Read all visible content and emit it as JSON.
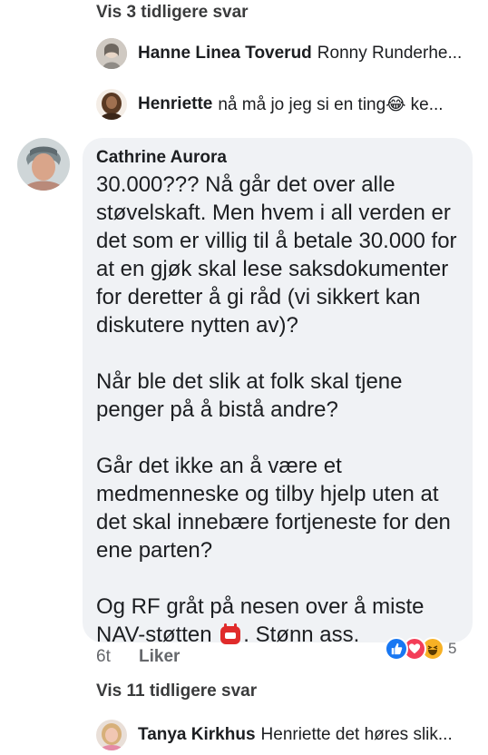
{
  "top_more_replies": "Vis 3 tidligere svar",
  "replies_top": [
    {
      "name": "Hanne Linea Toverud",
      "text": "Ronny Runderhe..."
    },
    {
      "name": "Henriette",
      "text": "nå må jo jeg si en ting😂 ke..."
    }
  ],
  "comment": {
    "author": "Cathrine Aurora",
    "paragraphs": [
      "30.000??? Nå går det over alle støvelskaft. Men hvem i all verden er det som er villig til å betale 30.000 for at en gjøk skal lese saksdokumenter for deretter å gi råd (vi sikkert kan diskutere nytten av)?",
      "Når ble det slik at folk skal tjene penger på å bistå andre?",
      "Går det ikke an å være et medmenneske og tilby hjelp uten at det skal innebære fortjeneste for den ene parten?",
      "Og RF gråt på nesen over å miste NAV-støtten",
      ". Stønn ass."
    ],
    "time": "6t",
    "like_label": "Liker",
    "reaction_count": "5"
  },
  "bottom_more_replies": "Vis 11 tidligere svar",
  "reply_bottom": {
    "name": "Tanya Kirkhus",
    "text": "Henriette det høres slik..."
  },
  "colors": {
    "bubble": "#f0f2f5",
    "like_blue": "#1877f2",
    "love_red": "#f33e58",
    "haha_yellow": "#f7b125"
  }
}
